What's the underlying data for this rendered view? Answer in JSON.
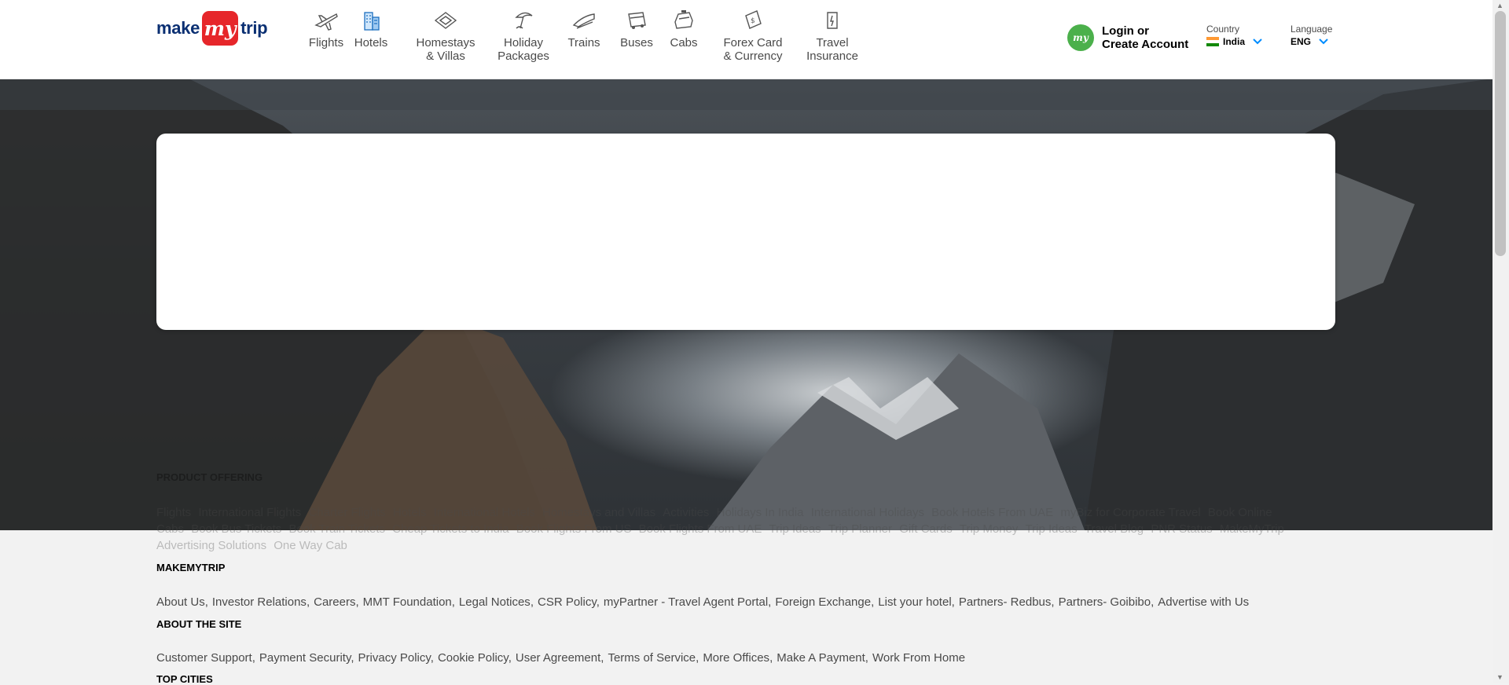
{
  "logo": {
    "left": "make",
    "mid": "my",
    "right": "trip"
  },
  "nav": [
    {
      "label": "Flights",
      "icon": "flight-icon",
      "active": false
    },
    {
      "label": "Hotels",
      "icon": "hotel-icon",
      "active": true
    },
    {
      "label": "Homestays\n& Villas",
      "icon": "homestay-icon",
      "active": false
    },
    {
      "label": "Holiday\nPackages",
      "icon": "holiday-icon",
      "active": false
    },
    {
      "label": "Trains",
      "icon": "train-icon",
      "active": false
    },
    {
      "label": "Buses",
      "icon": "bus-icon",
      "active": false
    },
    {
      "label": "Cabs",
      "icon": "cab-icon",
      "active": false
    },
    {
      "label": "Forex Card\n& Currency",
      "icon": "forex-icon",
      "active": false
    },
    {
      "label": "Travel\nInsurance",
      "icon": "insurance-icon",
      "active": false
    }
  ],
  "account": {
    "avatar": "my",
    "line1": "Login or",
    "line2": "Create Account"
  },
  "country": {
    "caption": "Country",
    "value": "India"
  },
  "language": {
    "caption": "Language",
    "value": "ENG"
  },
  "footer": {
    "product_offering": {
      "title": "PRODUCT OFFERING",
      "links": [
        "Flights",
        "International Flights",
        "Charter Flights",
        "Hotels",
        "International Hotels",
        "Homestays and Villas",
        "Activities",
        "Holidays In India",
        "International Holidays",
        "Book Hotels From UAE",
        "myBiz for Corporate Travel",
        "Book Online Cabs",
        "Book Bus Tickets",
        "Book Train Tickets",
        "Cheap Tickets to India",
        "Book Flights From US",
        "Book Flights From UAE",
        "Trip Ideas",
        "Trip Planner",
        "Gift Cards",
        "Trip Money",
        "Trip Ideas",
        "Travel Blog",
        "PNR Status",
        "MakeMyTrip Advertising Solutions",
        "One Way Cab"
      ]
    },
    "makemytrip": {
      "title": "MAKEMYTRIP",
      "links": [
        "About Us",
        "Investor Relations",
        "Careers",
        "MMT Foundation",
        "Legal Notices",
        "CSR Policy",
        "myPartner - Travel Agent Portal",
        "Foreign Exchange",
        "List your hotel",
        "Partners- Redbus",
        "Partners- Goibibo",
        "Advertise with Us"
      ]
    },
    "about_site": {
      "title": "ABOUT THE SITE",
      "links": [
        "Customer Support",
        "Payment Security",
        "Privacy Policy",
        "Cookie Policy",
        "User Agreement",
        "Terms of Service",
        "More Offices",
        "Make A Payment",
        "Work From Home"
      ]
    },
    "top_cities": {
      "title": "TOP CITIES"
    }
  },
  "colors": {
    "brand_blue": "#008cff",
    "logo_red": "#e6262a",
    "logo_navy": "#0a2f72"
  }
}
